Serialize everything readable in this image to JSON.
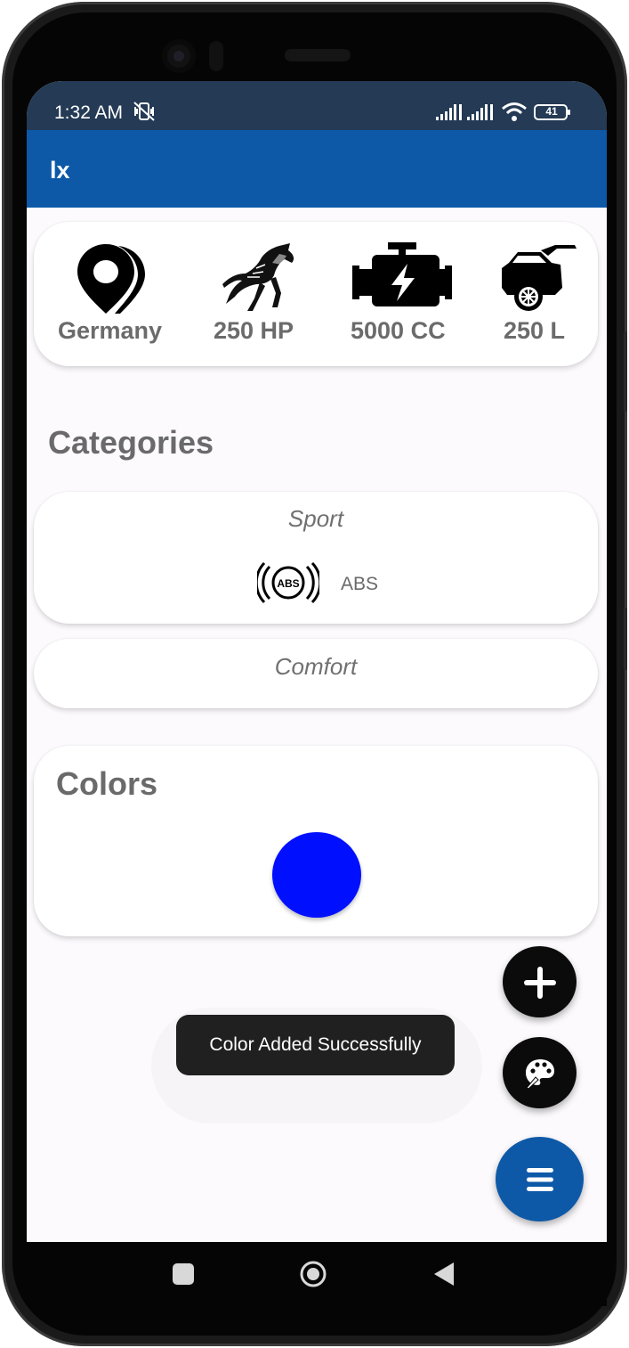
{
  "status_bar": {
    "time": "1:32 AM",
    "battery": "41"
  },
  "app_bar": {
    "title": "lx"
  },
  "specs": [
    {
      "icon": "location-pin-icon",
      "label": "Germany"
    },
    {
      "icon": "horse-icon",
      "label": "250 HP"
    },
    {
      "icon": "engine-icon",
      "label": "5000 CC"
    },
    {
      "icon": "car-trunk-icon",
      "label": "250 L"
    }
  ],
  "categories": {
    "title": "Categories",
    "items": [
      {
        "name": "Sport",
        "features": [
          {
            "icon": "abs-icon",
            "label": "ABS"
          }
        ]
      },
      {
        "name": "Comfort",
        "features": []
      }
    ]
  },
  "colors": {
    "title": "Colors",
    "swatches": [
      "#0010ff"
    ]
  },
  "toast": {
    "message": "Color Added Successfully"
  },
  "fabs": [
    {
      "icon": "plus-icon",
      "color": "#0b0b0b"
    },
    {
      "icon": "palette-icon",
      "color": "#0b0b0b"
    },
    {
      "icon": "menu-icon",
      "color": "#0d59a8"
    }
  ]
}
